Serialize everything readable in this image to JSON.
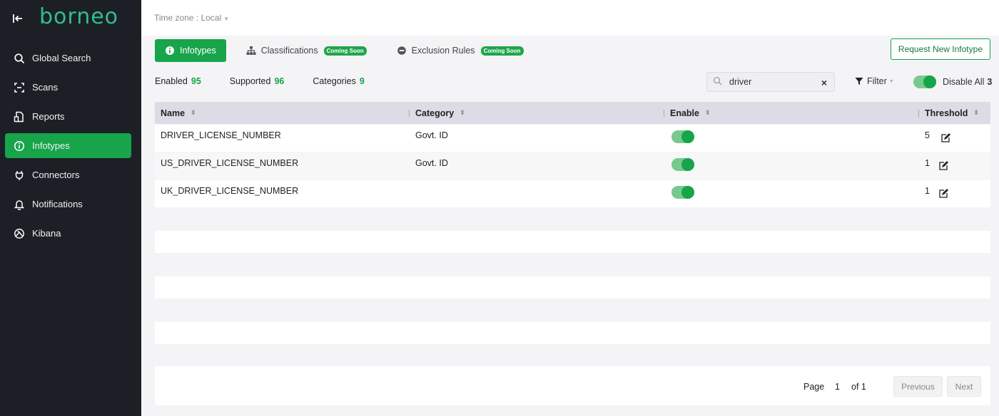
{
  "app": {
    "logo": "borneo"
  },
  "sidebar": {
    "items": [
      {
        "label": "Global Search",
        "icon": "search-icon"
      },
      {
        "label": "Scans",
        "icon": "scan-icon"
      },
      {
        "label": "Reports",
        "icon": "reports-icon"
      },
      {
        "label": "Infotypes",
        "icon": "info-circle-icon",
        "active": true
      },
      {
        "label": "Connectors",
        "icon": "plug-icon"
      },
      {
        "label": "Notifications",
        "icon": "bell-icon"
      },
      {
        "label": "Kibana",
        "icon": "kibana-icon"
      }
    ]
  },
  "topbar": {
    "timezone": "Time zone : Local"
  },
  "tabs": [
    {
      "label": "Infotypes",
      "active": true
    },
    {
      "label": "Classifications",
      "badge": "Coming Soon"
    },
    {
      "label": "Exclusion Rules",
      "badge": "Coming Soon"
    }
  ],
  "actions": {
    "request_new": "Request New Infotype"
  },
  "stats": [
    {
      "label": "Enabled",
      "value": "95"
    },
    {
      "label": "Supported",
      "value": "96"
    },
    {
      "label": "Categories",
      "value": "9"
    }
  ],
  "search": {
    "value": "driver",
    "clear": "×"
  },
  "filter": {
    "label": "Filter"
  },
  "disable_all": {
    "label": "Disable All",
    "count": "3",
    "enabled": true
  },
  "table": {
    "headers": [
      "Name",
      "Category",
      "Enable",
      "Threshold"
    ],
    "rows": [
      {
        "name": "DRIVER_LICENSE_NUMBER",
        "category": "Govt. ID",
        "enabled": true,
        "threshold": "5"
      },
      {
        "name": "US_DRIVER_LICENSE_NUMBER",
        "category": "Govt. ID",
        "enabled": true,
        "threshold": "1"
      },
      {
        "name": "UK_DRIVER_LICENSE_NUMBER",
        "category": "",
        "enabled": true,
        "threshold": "1"
      }
    ]
  },
  "pagination": {
    "page_label": "Page",
    "current": "1",
    "of_label": "of 1",
    "previous": "Previous",
    "next": "Next"
  },
  "colors": {
    "sidebar_bg": "#1c1f26",
    "accent": "#17a44a",
    "logo": "#2fbf8f",
    "header_bg": "#dcdbe6"
  }
}
